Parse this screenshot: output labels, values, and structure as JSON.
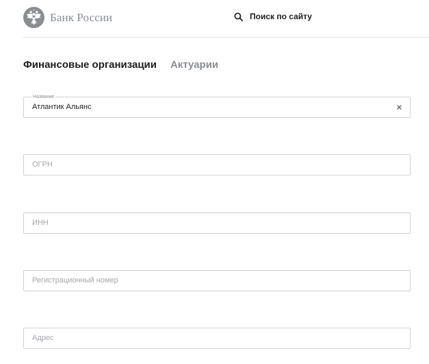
{
  "header": {
    "logo_text": "Банк России",
    "logo_icon": "double-headed-eagle-emblem",
    "search_label": "Поиск по сайту",
    "search_icon": "search-icon"
  },
  "tabs": [
    {
      "label": "Финансовые организации",
      "active": true
    },
    {
      "label": "Актуарии",
      "active": false
    }
  ],
  "form": {
    "name_field": {
      "label": "Название",
      "value": "Атлантик Альянс",
      "clear_icon": "close-icon"
    },
    "ogrn_field": {
      "placeholder": "ОГРН"
    },
    "inn_field": {
      "placeholder": "ИНН"
    },
    "reg_number_field": {
      "placeholder": "Регистрационный номер"
    },
    "address_field": {
      "placeholder": "Адрес"
    }
  },
  "colors": {
    "text_primary": "#1d1d1f",
    "text_muted": "#8a8d91",
    "border": "#cfd1d4",
    "divider": "#e4e5e7"
  }
}
